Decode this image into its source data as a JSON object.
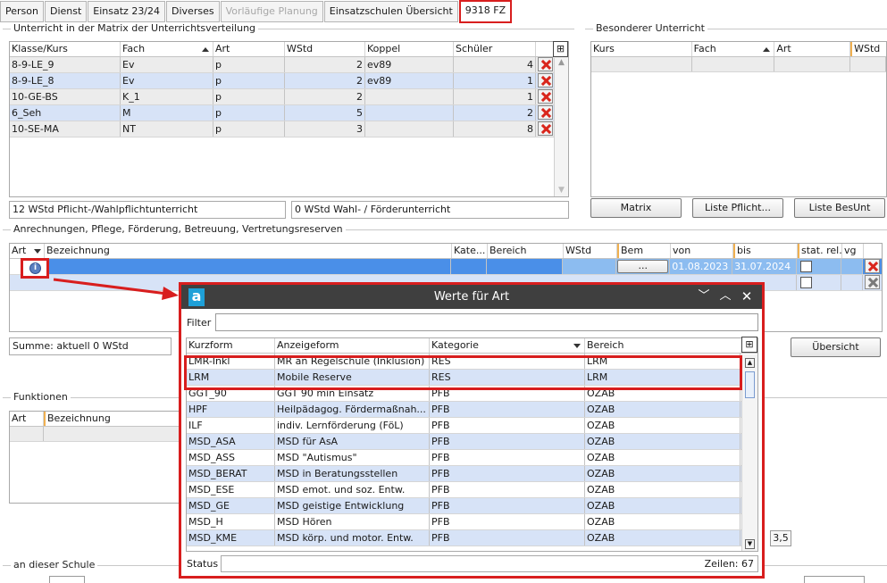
{
  "tabs": [
    {
      "label": "Person",
      "state": "normal"
    },
    {
      "label": "Dienst",
      "state": "normal"
    },
    {
      "label": "Einsatz 23/24",
      "state": "normal"
    },
    {
      "label": "Diverses",
      "state": "normal"
    },
    {
      "label": "Vorläufige Planung",
      "state": "disabled"
    },
    {
      "label": "Einsatzschulen Übersicht",
      "state": "normal"
    },
    {
      "label": "9318 FZ",
      "state": "active"
    }
  ],
  "matrix": {
    "legend": "Unterricht in der Matrix der Unterrichtsverteilung",
    "headers": [
      "Klasse/Kurs",
      "Fach",
      "Art",
      "WStd",
      "Koppel",
      "Schüler"
    ],
    "rows": [
      {
        "klasse": "8-9-LE_9",
        "fach": "Ev",
        "art": "p",
        "wstd": "2",
        "koppel": "ev89",
        "schueler": "4"
      },
      {
        "klasse": "8-9-LE_8",
        "fach": "Ev",
        "art": "p",
        "wstd": "2",
        "koppel": "ev89",
        "schueler": "1"
      },
      {
        "klasse": "10-GE-BS",
        "fach": "K_1",
        "art": "p",
        "wstd": "2",
        "koppel": "",
        "schueler": "1"
      },
      {
        "klasse": "6_Seh",
        "fach": "M",
        "art": "p",
        "wstd": "5",
        "koppel": "",
        "schueler": "2"
      },
      {
        "klasse": "10-SE-MA",
        "fach": "NT",
        "art": "p",
        "wstd": "3",
        "koppel": "",
        "schueler": "8"
      }
    ],
    "summary_pflicht": "12 WStd Pflicht-/Wahlpflichtunterricht",
    "summary_wahl": "0 WStd Wahl- / Förderunterricht"
  },
  "besonderer": {
    "legend": "Besonderer Unterricht",
    "headers": [
      "Kurs",
      "Fach",
      "Art",
      "WStd"
    ],
    "buttons": [
      "Matrix",
      "Liste Pflicht...",
      "Liste BesUnt"
    ]
  },
  "anrechnungen": {
    "legend": "Anrechnungen, Pflege, Förderung, Betreuung, Vertretungsreserven",
    "headers": [
      "Art",
      "Bezeichnung",
      "Kate...",
      "Bereich",
      "WStd",
      "Bem",
      "von",
      "bis",
      "stat. rel.",
      "vg"
    ],
    "row": {
      "bem": "...",
      "von": "01.08.2023",
      "bis": "31.07.2024"
    },
    "summe": "Summe: aktuell 0 WStd",
    "uebersicht": "Übersicht"
  },
  "funktionen": {
    "legend": "Funktionen",
    "headers": [
      "Art",
      "Bezeichnung"
    ]
  },
  "stepper_value": "3,5",
  "schule_legend": "an dieser Schule",
  "dialog": {
    "logo": "a",
    "title": "Werte für Art",
    "filter_label": "Filter",
    "filter_value": "",
    "headers": [
      "Kurzform",
      "Anzeigeform",
      "Kategorie",
      "Bereich"
    ],
    "rows": [
      {
        "k": "LMR-Inkl",
        "a": "MR an Regelschule (Inklusion)",
        "c": "RES",
        "b": "LRM"
      },
      {
        "k": "LRM",
        "a": "Mobile Reserve",
        "c": "RES",
        "b": "LRM"
      },
      {
        "k": "GGT_90",
        "a": "GGT 90 min Einsatz",
        "c": "PFB",
        "b": "OZAB"
      },
      {
        "k": "HPF",
        "a": "Heilpädagog. Fördermaßnah...",
        "c": "PFB",
        "b": "OZAB"
      },
      {
        "k": "ILF",
        "a": "indiv. Lernförderung (FöL)",
        "c": "PFB",
        "b": "OZAB"
      },
      {
        "k": "MSD_ASA",
        "a": "MSD für AsA",
        "c": "PFB",
        "b": "OZAB"
      },
      {
        "k": "MSD_ASS",
        "a": "MSD \"Autismus\"",
        "c": "PFB",
        "b": "OZAB"
      },
      {
        "k": "MSD_BERAT",
        "a": "MSD in Beratungsstellen",
        "c": "PFB",
        "b": "OZAB"
      },
      {
        "k": "MSD_ESE",
        "a": "MSD emot. und soz. Entw.",
        "c": "PFB",
        "b": "OZAB"
      },
      {
        "k": "MSD_GE",
        "a": "MSD geistige Entwicklung",
        "c": "PFB",
        "b": "OZAB"
      },
      {
        "k": "MSD_H",
        "a": "MSD Hören",
        "c": "PFB",
        "b": "OZAB"
      },
      {
        "k": "MSD_KME",
        "a": "MSD körp. und motor. Entw.",
        "c": "PFB",
        "b": "OZAB"
      }
    ],
    "status_label": "Status",
    "zeilen": "Zeilen: 67"
  },
  "colors": {
    "highlight": "#d81e1e",
    "selection": "#4a8fe8",
    "alt_row": "#d7e3f7",
    "dialog_title": "#3f3f3f"
  }
}
